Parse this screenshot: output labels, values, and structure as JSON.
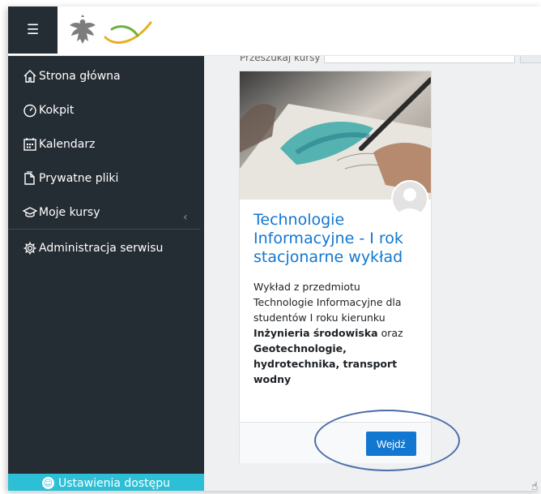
{
  "nav": {
    "items": [
      {
        "label": "Strona główna",
        "icon": "home-icon"
      },
      {
        "label": "Kokpit",
        "icon": "dashboard-icon"
      },
      {
        "label": "Kalendarz",
        "icon": "calendar-icon"
      },
      {
        "label": "Prywatne pliki",
        "icon": "file-icon"
      },
      {
        "label": "Moje kursy",
        "icon": "graduation-cap-icon"
      },
      {
        "label": "Administracja serwisu",
        "icon": "gear-icon"
      }
    ],
    "accessibility_label": "Ustawienia dostępu"
  },
  "search": {
    "label": "Przeszukaj kursy"
  },
  "course": {
    "title": "Technologie Informacyjne - I rok stacjonarne wykład",
    "desc_1": "Wykład z przedmiotu Technologie Informacyjne dla studentów I roku kierunku ",
    "desc_bold_1": "Inżynieria środowiska",
    "desc_2": " oraz ",
    "desc_bold_2": "Geotechnologie, hydrotechnika, transport wodny",
    "enter_label": "Wejdź"
  },
  "colors": {
    "sidebar": "#252d34",
    "accent": "#1177d1",
    "access_bar": "#2dbfd6"
  }
}
